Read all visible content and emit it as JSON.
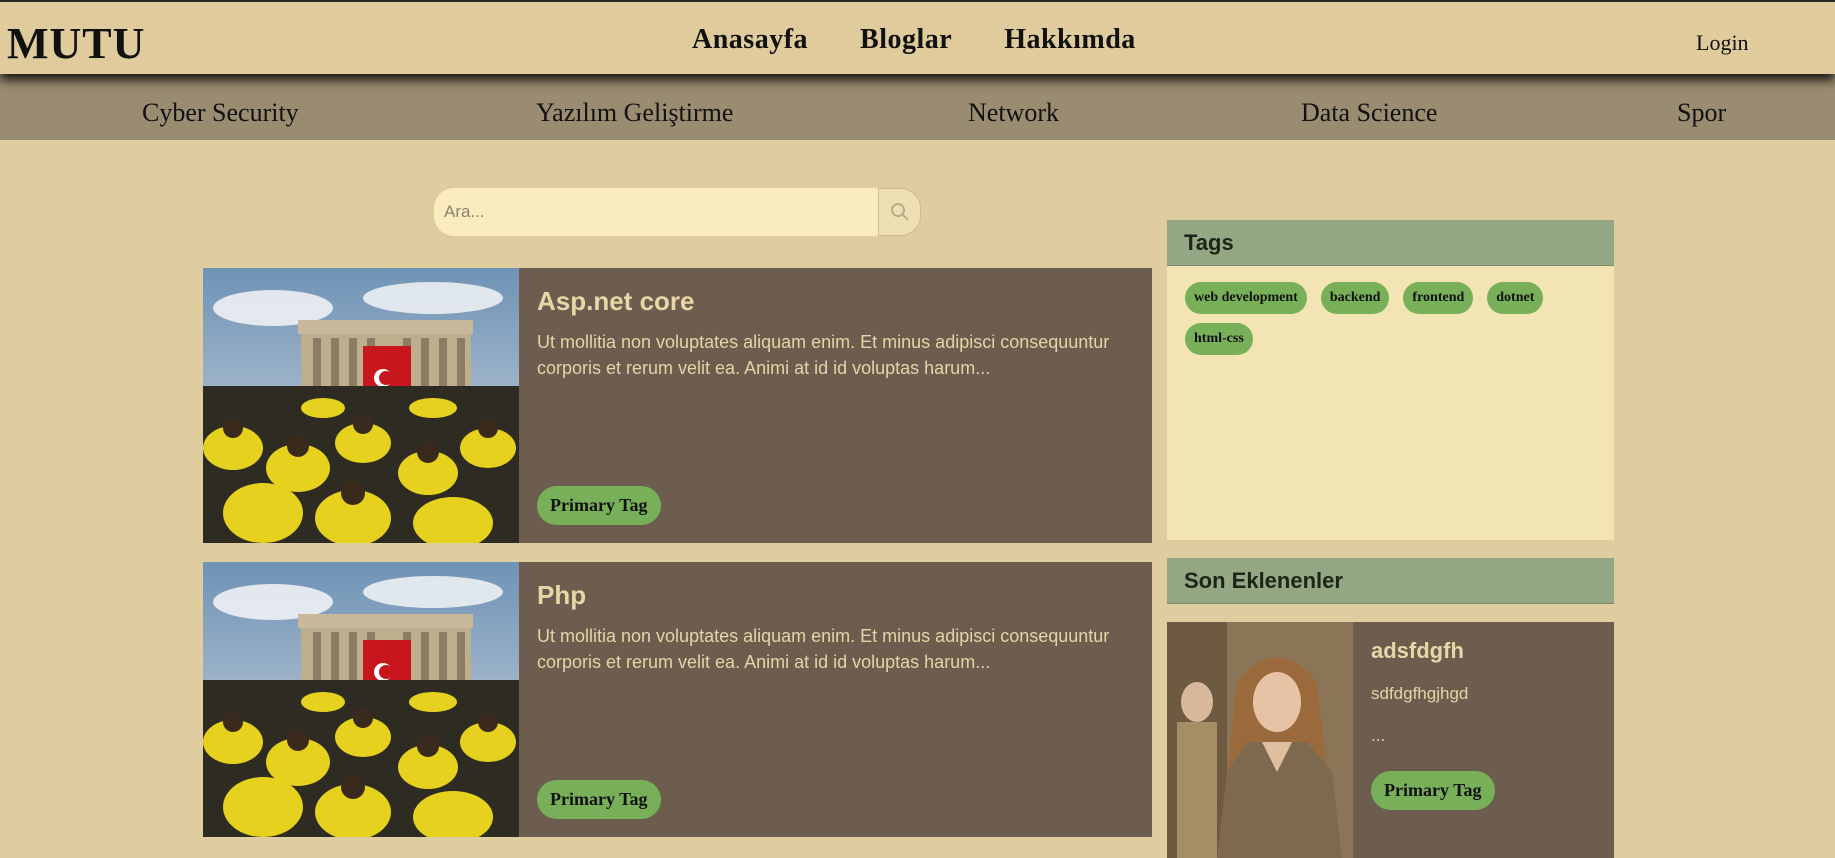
{
  "navbar": {
    "brand": "MUTU",
    "links": [
      "Anasayfa",
      "Bloglar",
      "Hakkımda"
    ],
    "login": "Login"
  },
  "categories": [
    "Cyber Security",
    "Yazılım Geliştirme",
    "Network",
    "Data Science",
    "Spor"
  ],
  "search": {
    "placeholder": "Ara...",
    "icon": "search-icon"
  },
  "posts": [
    {
      "title": "Asp.net core",
      "excerpt": "Ut mollitia non voluptates aliquam enim. Et minus adipisci consequuntur corporis et rerum velit ea. Animi at id id voluptas harum...",
      "tag": "Primary Tag"
    },
    {
      "title": "Php",
      "excerpt": "Ut mollitia non voluptates aliquam enim. Et minus adipisci consequuntur corporis et rerum velit ea. Animi at id id voluptas harum...",
      "tag": "Primary Tag"
    }
  ],
  "sidebar": {
    "tags_heading": "Tags",
    "tags": [
      "web development",
      "backend",
      "frontend",
      "dotnet",
      "html-css"
    ],
    "recent_heading": "Son Eklenenler",
    "recent": {
      "title": "adsfdgfh",
      "text": "sdfdgfhgjhgd",
      "more": "...",
      "tag": "Primary Tag"
    }
  },
  "colors": {
    "page_bg": "#dfcda0",
    "navbar_bg": "#dfcb9c",
    "category_bar": "#9a8c70",
    "card_bg": "#6c5d4f",
    "tag_green": "#78b05a",
    "sidebar_head": "#93a784",
    "tags_panel": "#f2e4b3"
  }
}
